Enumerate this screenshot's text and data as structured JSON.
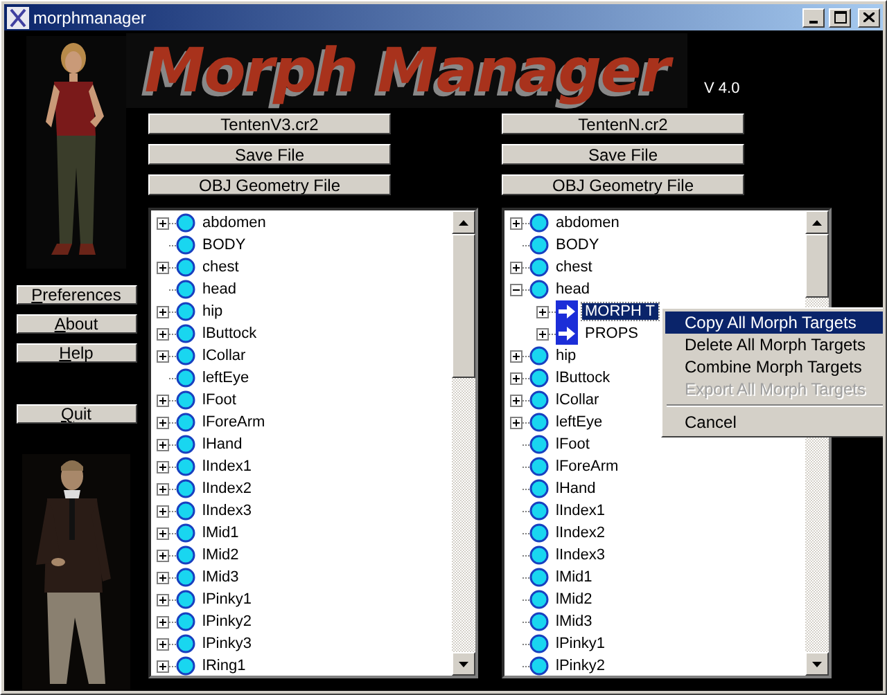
{
  "window": {
    "title": "morphmanager"
  },
  "logo": {
    "title": "Morph Manager",
    "version": "V 4.0"
  },
  "side_buttons": [
    {
      "key": "P",
      "rest": "references"
    },
    {
      "key": "A",
      "rest": "bout"
    },
    {
      "key": "H",
      "rest": "elp"
    },
    {
      "key": "Q",
      "rest": "uit"
    }
  ],
  "panels": [
    {
      "file_button": "TentenV3.cr2",
      "save_button": "Save File",
      "obj_button": "OBJ Geometry File",
      "tree": [
        {
          "label": "abdomen",
          "kind": "bone",
          "expandable": true,
          "expanded": false,
          "selected": false
        },
        {
          "label": "BODY",
          "kind": "bone",
          "expandable": false,
          "selected": false
        },
        {
          "label": "chest",
          "kind": "bone",
          "expandable": true,
          "expanded": false,
          "selected": false
        },
        {
          "label": "head",
          "kind": "bone",
          "expandable": false,
          "selected": false
        },
        {
          "label": "hip",
          "kind": "bone",
          "expandable": true,
          "expanded": false,
          "selected": false
        },
        {
          "label": "lButtock",
          "kind": "bone",
          "expandable": true,
          "expanded": false,
          "selected": false
        },
        {
          "label": "lCollar",
          "kind": "bone",
          "expandable": true,
          "expanded": false,
          "selected": false
        },
        {
          "label": "leftEye",
          "kind": "bone",
          "expandable": false,
          "selected": false
        },
        {
          "label": "lFoot",
          "kind": "bone",
          "expandable": true,
          "expanded": false,
          "selected": false
        },
        {
          "label": "lForeArm",
          "kind": "bone",
          "expandable": true,
          "expanded": false,
          "selected": false
        },
        {
          "label": "lHand",
          "kind": "bone",
          "expandable": true,
          "expanded": false,
          "selected": false
        },
        {
          "label": "lIndex1",
          "kind": "bone",
          "expandable": true,
          "expanded": false,
          "selected": false
        },
        {
          "label": "lIndex2",
          "kind": "bone",
          "expandable": true,
          "expanded": false,
          "selected": false
        },
        {
          "label": "lIndex3",
          "kind": "bone",
          "expandable": true,
          "expanded": false,
          "selected": false
        },
        {
          "label": "lMid1",
          "kind": "bone",
          "expandable": true,
          "expanded": false,
          "selected": false
        },
        {
          "label": "lMid2",
          "kind": "bone",
          "expandable": true,
          "expanded": false,
          "selected": false
        },
        {
          "label": "lMid3",
          "kind": "bone",
          "expandable": true,
          "expanded": false,
          "selected": false
        },
        {
          "label": "lPinky1",
          "kind": "bone",
          "expandable": true,
          "expanded": false,
          "selected": false
        },
        {
          "label": "lPinky2",
          "kind": "bone",
          "expandable": true,
          "expanded": false,
          "selected": false
        },
        {
          "label": "lPinky3",
          "kind": "bone",
          "expandable": true,
          "expanded": false,
          "selected": false
        },
        {
          "label": "lRing1",
          "kind": "bone",
          "expandable": true,
          "expanded": false,
          "selected": false
        }
      ]
    },
    {
      "file_button": "TentenN.cr2",
      "save_button": "Save File",
      "obj_button": "OBJ Geometry File",
      "tree": [
        {
          "label": "abdomen",
          "kind": "bone",
          "expandable": true,
          "expanded": false,
          "selected": false
        },
        {
          "label": "BODY",
          "kind": "bone",
          "expandable": false,
          "selected": false
        },
        {
          "label": "chest",
          "kind": "bone",
          "expandable": true,
          "expanded": false,
          "selected": false
        },
        {
          "label": "head",
          "kind": "bone",
          "expandable": true,
          "expanded": true,
          "selected": false,
          "children": [
            {
              "label": "MORPH T",
              "kind": "folder",
              "expandable": true,
              "expanded": false,
              "selected": true
            },
            {
              "label": "PROPS",
              "kind": "folder",
              "expandable": true,
              "expanded": false,
              "selected": false
            }
          ]
        },
        {
          "label": "hip",
          "kind": "bone",
          "expandable": true,
          "expanded": false,
          "selected": false
        },
        {
          "label": "lButtock",
          "kind": "bone",
          "expandable": true,
          "expanded": false,
          "selected": false
        },
        {
          "label": "lCollar",
          "kind": "bone",
          "expandable": true,
          "expanded": false,
          "selected": false
        },
        {
          "label": "leftEye",
          "kind": "bone",
          "expandable": true,
          "expanded": false,
          "selected": false
        },
        {
          "label": "lFoot",
          "kind": "bone",
          "expandable": false,
          "selected": false
        },
        {
          "label": "lForeArm",
          "kind": "bone",
          "expandable": false,
          "selected": false
        },
        {
          "label": "lHand",
          "kind": "bone",
          "expandable": false,
          "selected": false
        },
        {
          "label": "lIndex1",
          "kind": "bone",
          "expandable": false,
          "selected": false
        },
        {
          "label": "lIndex2",
          "kind": "bone",
          "expandable": false,
          "selected": false
        },
        {
          "label": "lIndex3",
          "kind": "bone",
          "expandable": false,
          "selected": false
        },
        {
          "label": "lMid1",
          "kind": "bone",
          "expandable": false,
          "selected": false
        },
        {
          "label": "lMid2",
          "kind": "bone",
          "expandable": false,
          "selected": false
        },
        {
          "label": "lMid3",
          "kind": "bone",
          "expandable": false,
          "selected": false
        },
        {
          "label": "lPinky1",
          "kind": "bone",
          "expandable": false,
          "selected": false
        },
        {
          "label": "lPinky2",
          "kind": "bone",
          "expandable": false,
          "selected": false
        }
      ]
    }
  ],
  "context_menu": {
    "items": [
      {
        "label": "Copy All Morph Targets",
        "kind": "item",
        "selected": true,
        "disabled": false
      },
      {
        "label": "Delete All Morph Targets",
        "kind": "item",
        "selected": false,
        "disabled": false
      },
      {
        "label": "Combine Morph Targets",
        "kind": "item",
        "selected": false,
        "disabled": false
      },
      {
        "label": "Export All Morph Targets",
        "kind": "item",
        "selected": false,
        "disabled": true
      },
      {
        "kind": "separator"
      },
      {
        "label": "Cancel",
        "kind": "item",
        "selected": false,
        "disabled": false
      }
    ]
  }
}
